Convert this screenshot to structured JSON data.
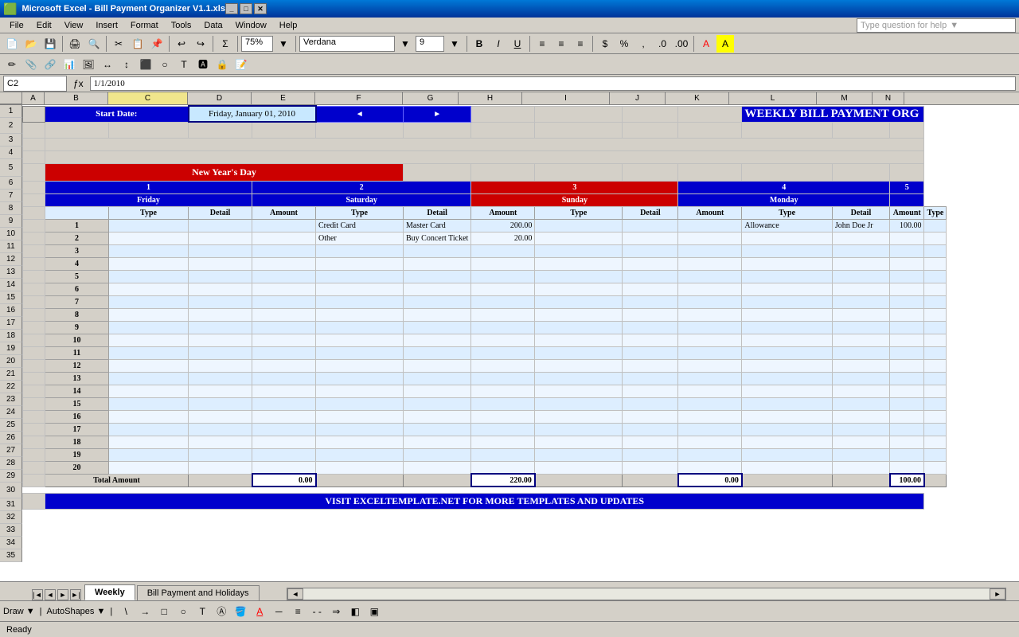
{
  "window": {
    "title": "Microsoft Excel - Bill Payment Organizer V1.1.xls",
    "title_icon": "📊"
  },
  "menu": {
    "items": [
      "File",
      "Edit",
      "View",
      "Insert",
      "Format",
      "Tools",
      "Data",
      "Window",
      "Help"
    ]
  },
  "help_placeholder": "Type question for help",
  "toolbar": {
    "zoom": "75%",
    "font": "Verdana",
    "font_size": "9",
    "bold": "B",
    "italic": "I",
    "underline": "U"
  },
  "formula_bar": {
    "name_box": "C2",
    "formula": "1/1/2010"
  },
  "spreadsheet": {
    "title": "WEEKLY BILL PAYMENT ORG",
    "start_date_label": "Start Date:",
    "start_date_value": "Friday, January 01, 2010",
    "holiday_label": "New Year's Day",
    "days": [
      {
        "num": "1",
        "name": "Friday"
      },
      {
        "num": "2",
        "name": "Saturday"
      },
      {
        "num": "3",
        "name": "Sunday"
      },
      {
        "num": "4",
        "name": "Monday"
      },
      {
        "num": "5",
        "name": ""
      }
    ],
    "col_labels": [
      "Type",
      "Detail",
      "Amount"
    ],
    "entries": [
      {
        "day_index": 1,
        "row": 1,
        "type": "",
        "detail": "",
        "amount": ""
      },
      {
        "day_index": 2,
        "row": 1,
        "type": "Credit Card",
        "detail": "Master Card",
        "amount": "200.00"
      },
      {
        "day_index": 2,
        "row": 2,
        "type": "Other",
        "detail": "Buy Concert Ticket",
        "amount": "20.00"
      },
      {
        "day_index": 4,
        "row": 1,
        "type": "Allowance",
        "detail": "John Doe Jr",
        "amount": "100.00"
      }
    ],
    "totals": [
      {
        "day": 1,
        "amount": "0.00"
      },
      {
        "day": 2,
        "amount": "220.00"
      },
      {
        "day": 3,
        "amount": "0.00"
      },
      {
        "day": 4,
        "amount": "100.00"
      }
    ],
    "footer_banner": "VISIT EXCELTEMPLATE.NET FOR MORE TEMPLATES AND UPDATES",
    "row_numbers": [
      "1",
      "2",
      "3",
      "4",
      "5",
      "6",
      "7",
      "8",
      "9",
      "10",
      "11",
      "12",
      "13",
      "14",
      "15",
      "16",
      "17",
      "18",
      "19",
      "20"
    ]
  },
  "tabs": [
    {
      "label": "Weekly",
      "active": true
    },
    {
      "label": "Bill Payment and Holidays",
      "active": false
    }
  ],
  "status": "Ready",
  "draw_toolbar": {
    "items": [
      "Draw ▼",
      "AutoShapes ▼"
    ]
  }
}
